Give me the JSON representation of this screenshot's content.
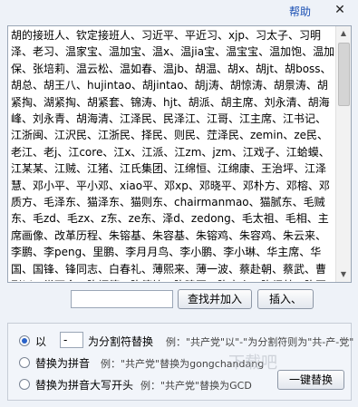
{
  "header": {
    "help_label": "帮助",
    "close_symbol": "✕"
  },
  "textbox": {
    "content": "胡的接班人、钦定接班人、习近平、平近习、xjp、习太子、习明泽、老习、温家宝、温加宝、温x、温jia宝、温宝宝、温加饱、温加保、张培莉、温云松、温如春、温jb、胡温、胡x、胡jt、胡boss、胡总、胡王八、hujintao、胡jintao、胡j涛、胡惊涛、胡景涛、胡紧掏、湖紧掏、胡紧套、锦涛、hjt、胡派、胡主席、刘永清、胡海峰、刘永青、胡海清、江泽民、民泽江、江哥、江主席、江书记、江浙闽、江沢民、江浙民、择民、则民、茳泽民、zemin、ze民、老江、老j、江core、江x、江派、江zm、jzm、江戏子、江蛤蟆、江某某、江贼、江猪、江氏集团、江绵恒、江绵康、王治坪、江泽慧、邓小平、平小邓、xiao平、邓xp、邓晓平、邓朴方、邓榕、邓质方、毛泽东、猫泽东、猫则东、chairmanmao、猫腻东、毛贼东、毛zd、毛zx、z东、ze东、泽d、zedong、毛太祖、毛相、主席画像、改革历程、朱镕基、朱容基、朱镕鸡、朱容鸡、朱云来、李鹏、李peng、里鹏、李月月鸟、李小鹏、李小琳、华主席、华国、国锋、锋同志、白春礼、薄熙来、薄一波、蔡赴朝、蔡武、曹刚川、常万全、陈炳德、陈德铭、陈建国、陈良宇、陈绍基、陈同海、陈至立、戴秉国、丁一平、董建华、杜德印、杜世成、傅锐、郭伯雄、郭金龙、贺国强、胡春华、耀邦、华建敏、黄华华、黄丽满、黄兴国、回良玉"
  },
  "search": {
    "value": ""
  },
  "buttons": {
    "find_add": "查找并加入",
    "insert": "插入、",
    "replace_all": "一键替换"
  },
  "options": {
    "sep_prefix": "以",
    "sep_value": "-",
    "sep_label": "为分割符替换",
    "sep_example": "例：\"共产党\"以\"-\"为分割符则为\"共-产-党\"",
    "pinyin_label": "替换为拼音",
    "pinyin_example": "例：\"共产党\"替换为gongchandang",
    "initials_label": "替换为拼音大写开头",
    "initials_example": "例：\"共产党\"替换为GCD",
    "selected": "separator"
  },
  "watermark": "下载吧"
}
